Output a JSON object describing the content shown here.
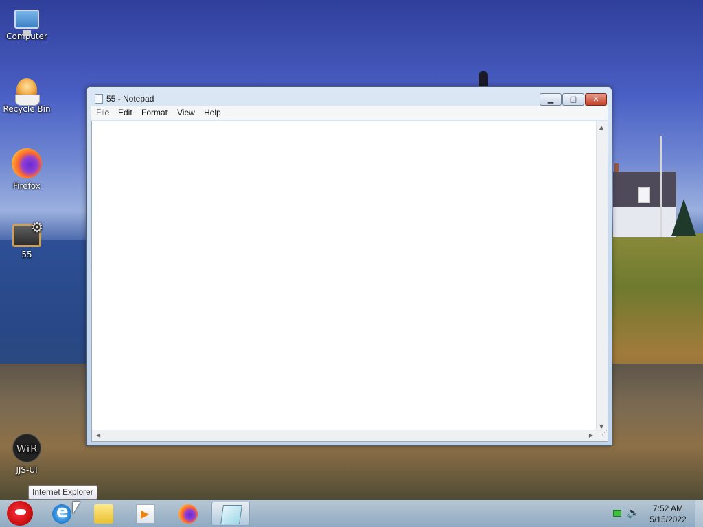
{
  "desktop": {
    "icons": [
      {
        "label": "Computer",
        "icon": "computer-icon"
      },
      {
        "label": "Recycle Bin",
        "icon": "recycle-bin-icon"
      },
      {
        "label": "Firefox",
        "icon": "firefox-icon"
      },
      {
        "label": "55",
        "icon": "notepad-file-icon"
      },
      {
        "label": "JJS-UI",
        "icon": "jjs-ui-icon",
        "glyph": "WiR"
      }
    ]
  },
  "window": {
    "title": "55 - Notepad",
    "controls": {
      "minimize": "▁",
      "maximize": "□",
      "close": "✕"
    },
    "menu": [
      "File",
      "Edit",
      "Format",
      "View",
      "Help"
    ],
    "content": "",
    "scroll_arrows": {
      "up": "▲",
      "down": "▼",
      "left": "◀",
      "right": "▶"
    }
  },
  "taskbar": {
    "apps": [
      {
        "name": "Internet Explorer",
        "icon": "internet-explorer-icon"
      },
      {
        "name": "Windows Explorer",
        "icon": "folder-icon"
      },
      {
        "name": "Media Player",
        "icon": "media-player-icon"
      },
      {
        "name": "Firefox",
        "icon": "firefox-icon"
      },
      {
        "name": "Notepad",
        "icon": "notepad-icon",
        "active": true
      }
    ],
    "tooltip": "Internet Explorer",
    "clock": {
      "time": "7:52 AM",
      "date": "5/15/2022"
    }
  }
}
